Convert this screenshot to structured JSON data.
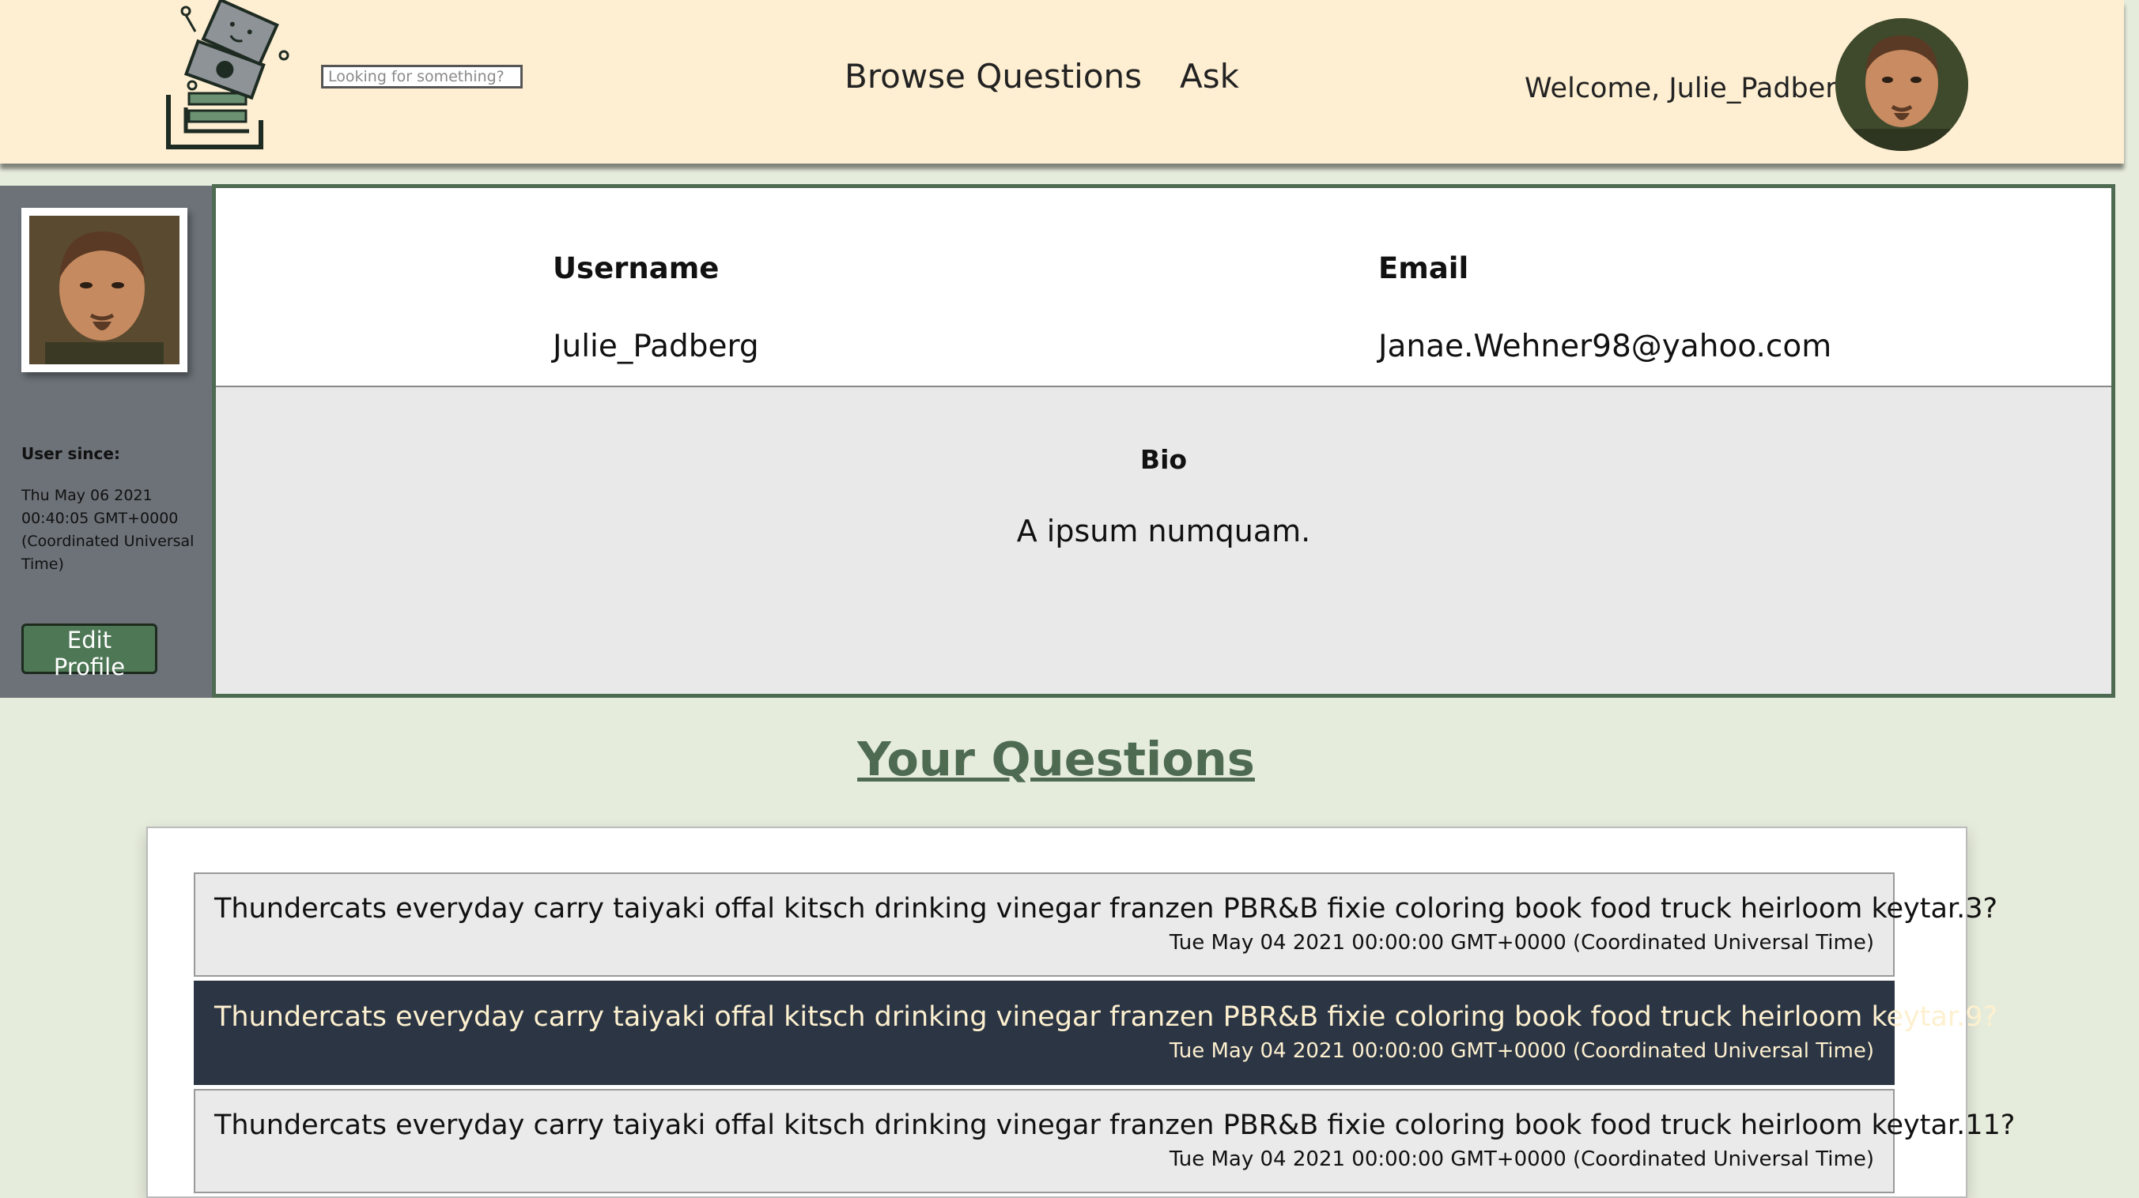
{
  "header": {
    "search_placeholder": "Looking for something?",
    "nav": [
      "Browse Questions",
      "Ask"
    ],
    "welcome": "Welcome, Julie_Padberg!"
  },
  "sidebar": {
    "since_label": "User since:",
    "since_value": "Thu May 06 2021 00:40:05 GMT+0000 (Coordinated Universal Time)",
    "edit_label": "Edit Profile"
  },
  "profile": {
    "username_label": "Username",
    "username": "Julie_Padberg",
    "email_label": "Email",
    "email": "Janae.Wehner98@yahoo.com",
    "bio_label": "Bio",
    "bio": "A ipsum numquam."
  },
  "questions": {
    "heading": "Your Questions",
    "items": [
      {
        "title": "Thundercats everyday carry taiyaki offal kitsch drinking vinegar franzen PBR&B fixie coloring book food truck heirloom keytar.3?",
        "date": "Tue May 04 2021 00:00:00 GMT+0000 (Coordinated Universal Time)"
      },
      {
        "title": "Thundercats everyday carry taiyaki offal kitsch drinking vinegar franzen PBR&B fixie coloring book food truck heirloom keytar.9?",
        "date": "Tue May 04 2021 00:00:00 GMT+0000 (Coordinated Universal Time)"
      },
      {
        "title": "Thundercats everyday carry taiyaki offal kitsch drinking vinegar franzen PBR&B fixie coloring book food truck heirloom keytar.11?",
        "date": "Tue May 04 2021 00:00:00 GMT+0000 (Coordinated Universal Time)"
      }
    ]
  },
  "colors": {
    "header_bg": "#feefd2",
    "page_bg": "#e6ecdc",
    "accent_green": "#4e6b52",
    "sidebar_bg": "#6c7278",
    "highlight_row": "#2b3544"
  }
}
